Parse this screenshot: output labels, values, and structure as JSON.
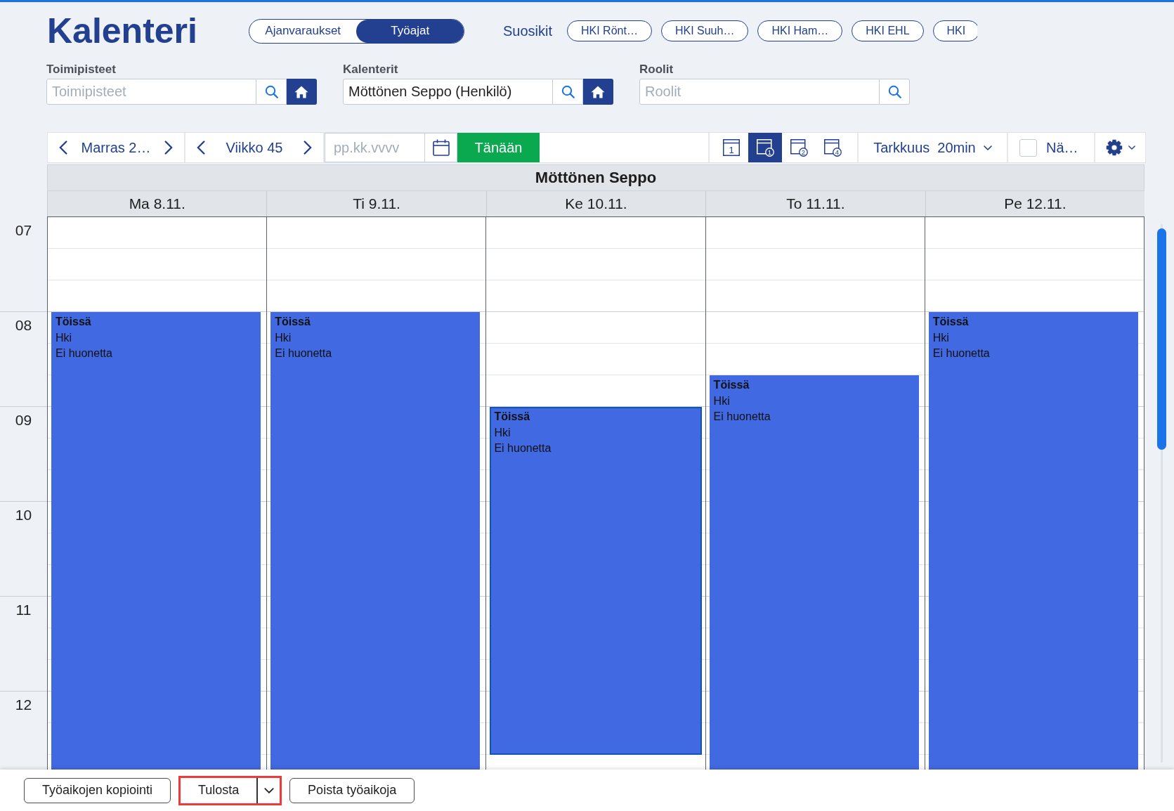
{
  "header": {
    "title": "Kalenteri",
    "mode_tabs": [
      {
        "label": "Ajanvaraukset",
        "selected": false
      },
      {
        "label": "Työajat",
        "selected": true
      }
    ],
    "favorites_label": "Suosikit",
    "favorites": [
      "HKI Rönt…",
      "HKI Suuh…",
      "HKI Ham…",
      "HKI EHL",
      "HKI"
    ]
  },
  "filters": [
    {
      "label": "Toimipisteet",
      "placeholder": "Toimipisteet",
      "actions": [
        {
          "kind": "search"
        },
        {
          "kind": "home"
        }
      ]
    },
    {
      "label": "Kalenterit",
      "value": "Möttönen Seppo (Henkilö)",
      "actions": [
        {
          "kind": "search"
        },
        {
          "kind": "home"
        }
      ]
    },
    {
      "label": "Roolit",
      "placeholder": "Roolit",
      "actions": [
        {
          "kind": "search"
        }
      ]
    }
  ],
  "toolbar": {
    "month": "Marras 2…",
    "week": "Viikko 45",
    "date_placeholder": "pp.kk.vvvv",
    "today": "Tänään",
    "views": [
      {
        "kind": "day",
        "number": "1",
        "selected": false
      },
      {
        "kind": "week",
        "number": "1",
        "selected": true
      },
      {
        "kind": "week",
        "number": "2",
        "selected": false
      },
      {
        "kind": "week",
        "number": "4",
        "selected": false
      }
    ],
    "resolution": {
      "label": "Tarkkuus",
      "value": "20min"
    },
    "show_option": {
      "label": "Nä…",
      "checked": false
    }
  },
  "calendar": {
    "person": "Möttönen Seppo",
    "hours": [
      "07",
      "08",
      "09",
      "10",
      "11",
      "12"
    ],
    "days": [
      {
        "label": "Ma 8.11.",
        "entries": [
          {
            "kind": "free"
          },
          {
            "kind": "free"
          },
          {
            "kind": "free"
          },
          {
            "kind": "shift",
            "title": "Töissä",
            "location": "Hki",
            "room": "Ei huonetta",
            "selected": false
          }
        ]
      },
      {
        "label": "Ti 9.11.",
        "entries": [
          {
            "kind": "free"
          },
          {
            "kind": "free"
          },
          {
            "kind": "free"
          },
          {
            "kind": "shift",
            "title": "Töissä",
            "location": "Hki",
            "room": "Ei huonetta",
            "selected": false
          }
        ]
      },
      {
        "label": "Ke 10.11.",
        "entries": [
          {
            "kind": "free"
          },
          {
            "kind": "free"
          },
          {
            "kind": "free"
          },
          {
            "kind": "free"
          },
          {
            "kind": "free"
          },
          {
            "kind": "free"
          },
          {
            "kind": "shift",
            "title": "Töissä",
            "location": "Hki",
            "room": "Ei huonetta",
            "selected": true
          },
          {
            "kind": "free"
          }
        ]
      },
      {
        "label": "To 11.11.",
        "entries": [
          {
            "kind": "free"
          },
          {
            "kind": "free"
          },
          {
            "kind": "free"
          },
          {
            "kind": "free"
          },
          {
            "kind": "free"
          },
          {
            "kind": "shift",
            "title": "Töissä",
            "location": "Hki",
            "room": "Ei huonetta",
            "selected": false
          }
        ]
      },
      {
        "label": "Pe 12.11.",
        "entries": [
          {
            "kind": "free"
          },
          {
            "kind": "free"
          },
          {
            "kind": "free"
          },
          {
            "kind": "shift",
            "title": "Töissä",
            "location": "Hki",
            "room": "Ei huonetta",
            "selected": false
          }
        ]
      }
    ]
  },
  "footer": {
    "buttons": [
      {
        "label": "Työaikojen kopiointi",
        "kind": "plain",
        "highlighted": false
      },
      {
        "label": "Tulosta",
        "kind": "split",
        "highlighted": true
      },
      {
        "label": "Poista työaikoja",
        "kind": "plain",
        "highlighted": false
      }
    ]
  }
}
